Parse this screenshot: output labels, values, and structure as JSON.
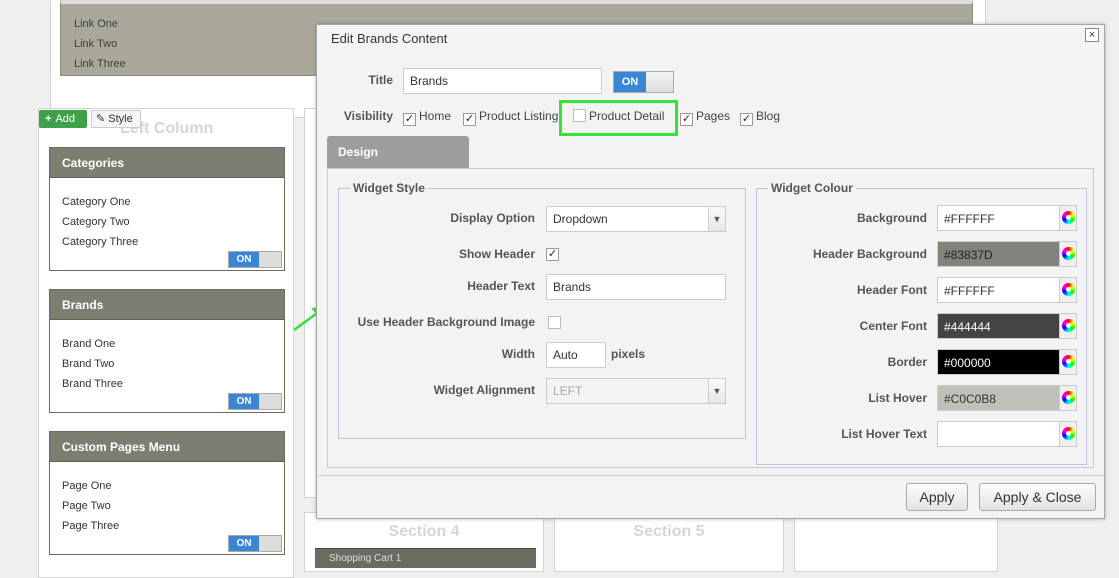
{
  "background": {
    "links": [
      "Link One",
      "Link Two",
      "Link Three"
    ],
    "left_column_title": "Left Column",
    "add_label": "Add",
    "style_label": "Style",
    "widgets": [
      {
        "title": "Categories",
        "items": [
          "Category One",
          "Category Two",
          "Category Three"
        ],
        "toggle": "ON"
      },
      {
        "title": "Brands",
        "items": [
          "Brand One",
          "Brand Two",
          "Brand Three"
        ],
        "toggle": "ON"
      },
      {
        "title": "Custom Pages Menu",
        "items": [
          "Page One",
          "Page Two",
          "Page Three"
        ],
        "toggle": "ON"
      }
    ],
    "sections": [
      "Section 4",
      "Section 5"
    ],
    "cart_title": "Shopping Cart 1"
  },
  "modal": {
    "title": "Edit Brands Content",
    "close_label": "×",
    "title_label": "Title",
    "title_value": "Brands",
    "title_toggle": "ON",
    "visibility_label": "Visibility",
    "visibility": [
      {
        "label": "Home",
        "checked": true
      },
      {
        "label": "Product Listing",
        "checked": true
      },
      {
        "label": "Product Detail",
        "checked": false
      },
      {
        "label": "Pages",
        "checked": true
      },
      {
        "label": "Blog",
        "checked": true
      }
    ],
    "tab_label": "Design",
    "widget_style": {
      "legend": "Widget Style",
      "display_option_label": "Display Option",
      "display_option_value": "Dropdown",
      "show_header_label": "Show Header",
      "show_header_checked": true,
      "header_text_label": "Header Text",
      "header_text_value": "Brands",
      "use_bg_image_label": "Use Header Background Image",
      "use_bg_image_checked": false,
      "width_label": "Width",
      "width_value": "Auto",
      "width_unit": "pixels",
      "alignment_label": "Widget Alignment",
      "alignment_value": "LEFT"
    },
    "widget_colour": {
      "legend": "Widget Colour",
      "rows": [
        {
          "label": "Background",
          "value": "#FFFFFF",
          "bg": "#FFFFFF",
          "fg": "#333333"
        },
        {
          "label": "Header Background",
          "value": "#83837D",
          "bg": "#83837D",
          "fg": "#222222"
        },
        {
          "label": "Header Font",
          "value": "#FFFFFF",
          "bg": "#FFFFFF",
          "fg": "#333333"
        },
        {
          "label": "Center Font",
          "value": "#444444",
          "bg": "#444444",
          "fg": "#FFFFFF"
        },
        {
          "label": "Border",
          "value": "#000000",
          "bg": "#000000",
          "fg": "#FFFFFF"
        },
        {
          "label": "List Hover",
          "value": "#C0C0B8",
          "bg": "#C0C0B8",
          "fg": "#333333"
        },
        {
          "label": "List Hover Text",
          "value": "",
          "bg": "#FFFFFF",
          "fg": "#333333"
        }
      ]
    },
    "apply_label": "Apply",
    "apply_close_label": "Apply & Close"
  }
}
